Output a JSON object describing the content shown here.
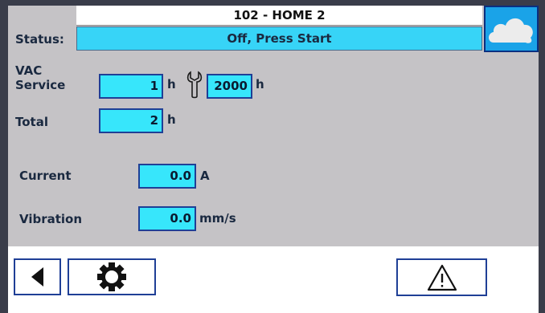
{
  "header": {
    "title": "102 - HOME 2",
    "cloud_icon": "cloud-icon"
  },
  "status": {
    "label": "Status:",
    "value": "Off, Press Start"
  },
  "vac_service": {
    "label_line1": "VAC",
    "label_line2": "Service",
    "hours": "1",
    "hours_unit": "h",
    "wrench_icon": "wrench-icon",
    "interval": "2000",
    "interval_unit": "h"
  },
  "total": {
    "label": "Total",
    "hours": "2",
    "unit": "h"
  },
  "current": {
    "label": "Current",
    "value": "0.0",
    "unit": "A"
  },
  "vibration": {
    "label": "Vibration",
    "value": "0.0",
    "unit": "mm/s"
  },
  "footer": {
    "back_icon": "back-arrow-icon",
    "settings_icon": "gear-icon",
    "alarm_icon": "warning-icon"
  },
  "colors": {
    "panel": "#c5c3c6",
    "field": "#37e6fb",
    "status_field": "#37d4f7",
    "cloud_bg": "#1aa3e8",
    "border": "#1f3f96"
  }
}
